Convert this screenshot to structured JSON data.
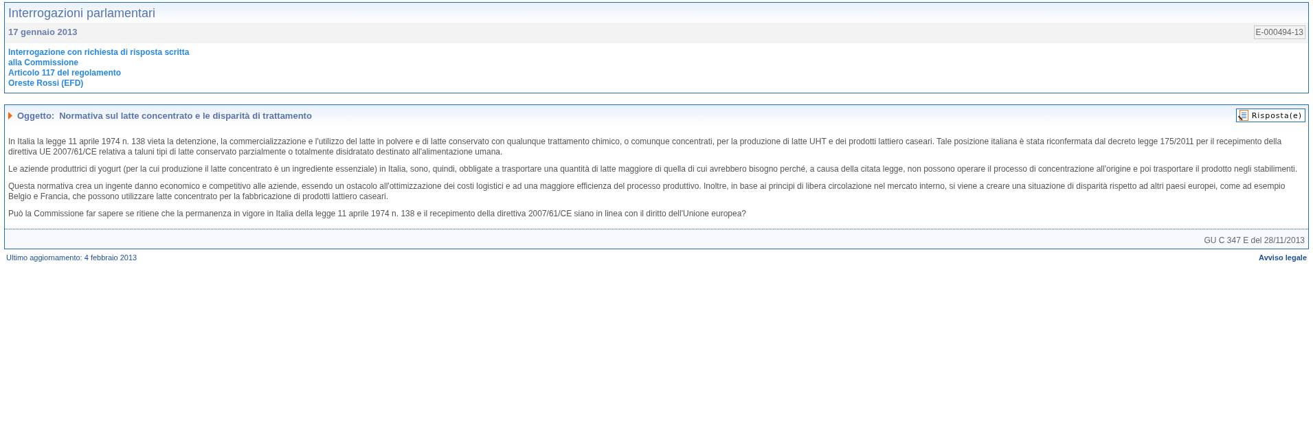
{
  "header_box": {
    "title": "Interrogazioni parlamentari",
    "date": "17 gennaio 2013",
    "reference": "E-000494-13",
    "details": [
      "Interrogazione con richiesta di risposta scritta",
      "alla Commissione",
      "Articolo 117 del regolamento",
      "Oreste Rossi (EFD)"
    ]
  },
  "question_box": {
    "subject_label": "Oggetto:",
    "subject": "Normativa sul latte concentrato e le disparità di trattamento",
    "answer_button": "Risposta(e)",
    "paragraphs": [
      "In Italia la legge 11 aprile 1974 n. 138 vieta la detenzione, la commercializzazione e l'utilizzo del latte in polvere e di latte conservato con qualunque trattamento chimico, o comunque concentrati, per la produzione di latte UHT e dei prodotti lattiero caseari. Tale posizione italiana è stata riconfermata dal decreto legge 175/2011 per il recepimento della direttiva UE 2007/61/CE relativa a taluni tipi di latte conservato parzialmente o totalmente disidratato destinato all'alimentazione umana.",
      "Le aziende produttrici di yogurt (per la cui produzione il latte concentrato è un ingrediente essenziale) in Italia, sono, quindi, obbligate a trasportare una quantità di latte maggiore di quella di cui avrebbero bisogno perché, a causa della citata legge, non possono operare il processo di concentrazione all'origine e poi trasportare il prodotto negli stabilimenti.",
      "Questa normativa crea un ingente danno economico e competitivo alle aziende, essendo un ostacolo all'ottimizzazione dei costi logistici e ad una maggiore efficienza del processo produttivo. Inoltre, in base ai principi di libera circolazione nel mercato interno, si viene a creare una situazione di disparità rispetto ad altri paesi europei, come ad esempio Belgio e Francia, che possono utilizzare latte concentrato per la fabbricazione di prodotti lattiero caseari.",
      "Può la Commissione far sapere se ritiene che la permanenza in vigore in Italia della legge 11 aprile 1974 n. 138 e il recepimento della direttiva 2007/61/CE siano in linea con il diritto dell'Unione europea?"
    ],
    "publication": "GU C 347 E del 28/11/2013"
  },
  "footer": {
    "last_update": "Ultimo aggiornamento: 4 febbraio 2013",
    "legal_link": "Avviso legale"
  }
}
